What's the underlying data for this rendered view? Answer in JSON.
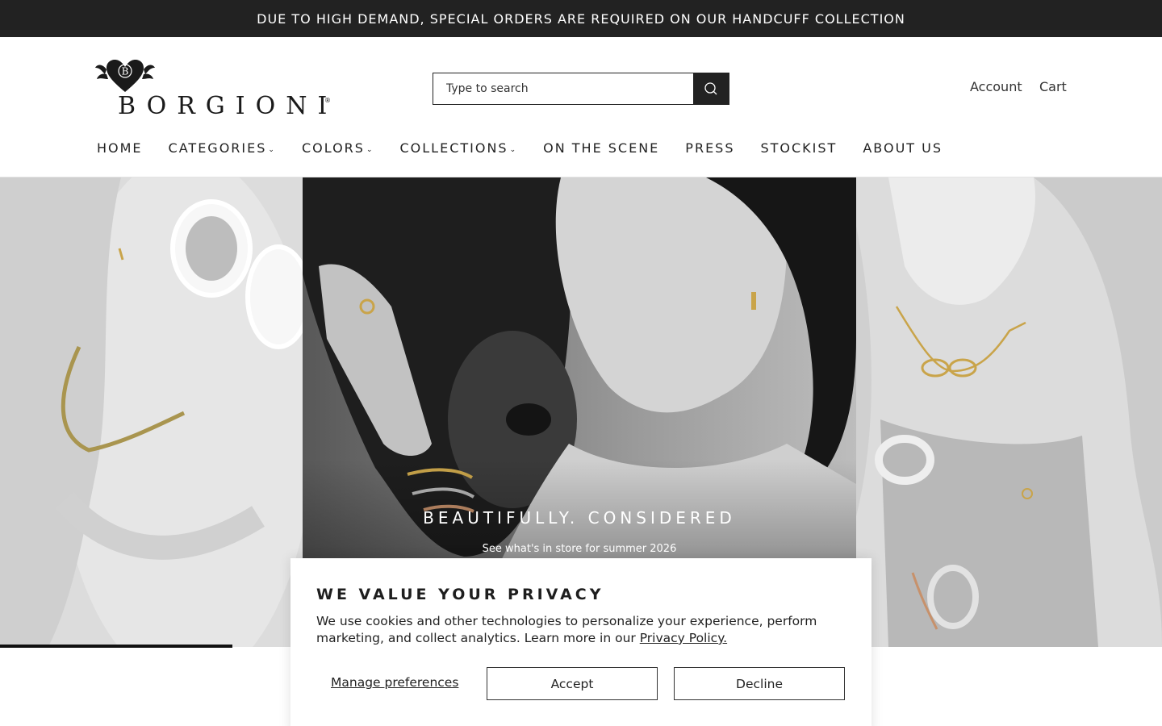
{
  "announcement": "DUE TO HIGH DEMAND, SPECIAL ORDERS ARE REQUIRED ON OUR HANDCUFF COLLECTION",
  "brand": {
    "name": "BORGIONI",
    "mark_letter": "B",
    "reg": "®"
  },
  "search": {
    "placeholder": "Type to search",
    "icon": "search-icon"
  },
  "header": {
    "account": "Account",
    "cart": "Cart"
  },
  "nav": [
    {
      "label": "HOME",
      "dropdown": false
    },
    {
      "label": "CATEGORIES",
      "dropdown": true
    },
    {
      "label": "COLORS",
      "dropdown": true
    },
    {
      "label": "COLLECTIONS",
      "dropdown": true
    },
    {
      "label": "ON THE SCENE",
      "dropdown": false
    },
    {
      "label": "PRESS",
      "dropdown": false
    },
    {
      "label": "STOCKIST",
      "dropdown": false
    },
    {
      "label": "ABOUT US",
      "dropdown": false
    }
  ],
  "hero": {
    "title": "BEAUTIFULLY. CONSIDERED",
    "subtitle": "See what's in store for summer 2026",
    "slide_progress": 0.2
  },
  "cookie": {
    "title": "WE VALUE YOUR PRIVACY",
    "text": "We use cookies and other technologies to personalize your experience, perform marketing, and collect analytics. Learn more in our ",
    "link": "Privacy Policy.",
    "manage": "Manage preferences",
    "accept": "Accept",
    "decline": "Decline"
  },
  "colors": {
    "announcement_bg": "#222222",
    "accent": "#222222",
    "gold": "#c9a44a"
  }
}
